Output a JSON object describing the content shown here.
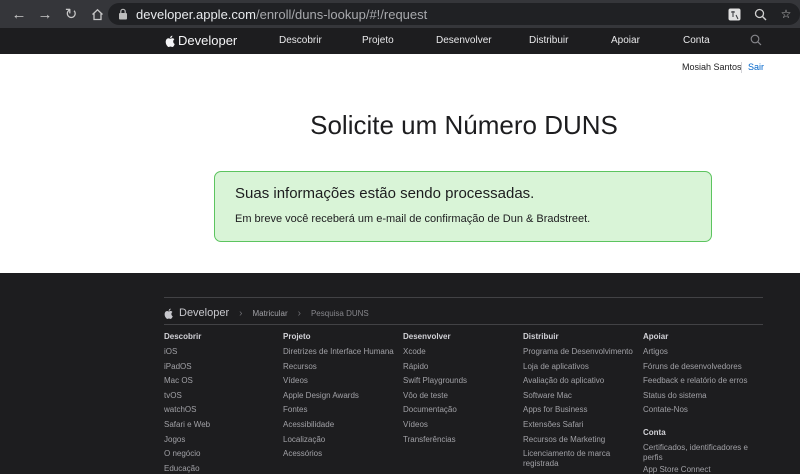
{
  "browser": {
    "url_domain": "developer.apple.com",
    "url_path": "/enroll/duns-lookup/#!/request"
  },
  "devnav": {
    "brand": "Developer",
    "items": [
      "Descobrir",
      "Projeto",
      "Desenvolver",
      "Distribuir",
      "Apoiar",
      "Conta"
    ]
  },
  "user": {
    "name": "Mosiah Santos",
    "signout": "Sair"
  },
  "page": {
    "title": "Solicite um Número DUNS",
    "notice_heading": "Suas informações estão sendo processadas.",
    "notice_body": "Em breve você receberá um e-mail de confirmação de Dun & Bradstreet."
  },
  "footer": {
    "brand": "Developer",
    "breadcrumb": [
      "Matricular",
      "Pesquisa DUNS"
    ],
    "columns": [
      {
        "heading": "Descobrir",
        "links": [
          "iOS",
          "iPadOS",
          "Mac OS",
          "tvOS",
          "watchOS",
          "Safari e Web",
          "Jogos",
          "O negócio",
          "Educação"
        ]
      },
      {
        "heading": "Projeto",
        "links": [
          "Diretrizes de Interface Humana",
          "Recursos",
          "Vídeos",
          "Apple Design Awards",
          "Fontes",
          "Acessibilidade",
          "Localização",
          "Acessórios"
        ]
      },
      {
        "heading": "Desenvolver",
        "links": [
          "Xcode",
          "Rápido",
          "Swift Playgrounds",
          "Vôo de teste",
          "Documentação",
          "Vídeos",
          "Transferências"
        ]
      },
      {
        "heading": "Distribuir",
        "links": [
          "Programa de Desenvolvimento",
          "Loja de aplicativos",
          "Avaliação do aplicativo",
          "Software Mac",
          "Apps for Business",
          "Extensões Safari",
          "Recursos de Marketing",
          "Licenciamento de marca registrada"
        ]
      },
      {
        "heading": "Apoiar",
        "links": [
          "Artigos",
          "Fóruns de desenvolvedores",
          "Feedback e relatório de erros",
          "Status do sistema",
          "Contate-Nos"
        ],
        "sub_heading": "Conta",
        "sub_links": [
          "Certificados, identificadores e perfis",
          "App Store Connect"
        ]
      }
    ]
  },
  "colors": {
    "nav_bg": "#1d1d1f",
    "notice_bg": "#d9f4d7",
    "notice_border": "#5cc45f",
    "link_blue": "#0066cc"
  }
}
